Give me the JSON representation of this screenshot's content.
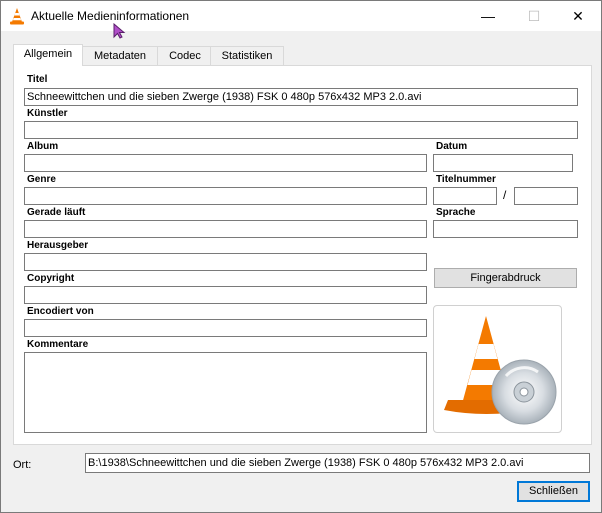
{
  "window": {
    "title": "Aktuelle Medieninformationen",
    "minimize_glyph": "—",
    "maximize_glyph": "☐",
    "close_glyph": "✕",
    "icon": "vlc-cone-icon"
  },
  "tabs": [
    {
      "label": "Allgemein",
      "active": true
    },
    {
      "label": "Metadaten",
      "active": false
    },
    {
      "label": "Codec",
      "active": false
    },
    {
      "label": "Statistiken",
      "active": false
    }
  ],
  "fields": {
    "titel": {
      "label": "Titel",
      "value": "Schneewittchen und die sieben Zwerge (1938) FSK 0 480p 576x432 MP3 2.0.avi"
    },
    "kuenstler": {
      "label": "Künstler",
      "value": ""
    },
    "album": {
      "label": "Album",
      "value": ""
    },
    "datum": {
      "label": "Datum",
      "value": ""
    },
    "genre": {
      "label": "Genre",
      "value": ""
    },
    "titelnummer": {
      "label": "Titelnummer",
      "value": "",
      "total": "",
      "separator": "/"
    },
    "gerade_laeuft": {
      "label": "Gerade läuft",
      "value": ""
    },
    "sprache": {
      "label": "Sprache",
      "value": ""
    },
    "herausgeber": {
      "label": "Herausgeber",
      "value": ""
    },
    "copyright": {
      "label": "Copyright",
      "value": ""
    },
    "encodiert_von": {
      "label": "Encodiert von",
      "value": ""
    },
    "kommentare": {
      "label": "Kommentare",
      "value": ""
    }
  },
  "fingerprint_button": {
    "label": "Fingerabdruck"
  },
  "ort": {
    "label": "Ort:",
    "value": "B:\\1938\\Schneewittchen und die sieben Zwerge (1938) FSK 0 480p 576x432 MP3 2.0.avi"
  },
  "close_button": {
    "label": "Schließen"
  },
  "colors": {
    "cone_orange": "#f47a00",
    "cone_white": "#ffffff",
    "focus_blue": "#0078d7"
  }
}
